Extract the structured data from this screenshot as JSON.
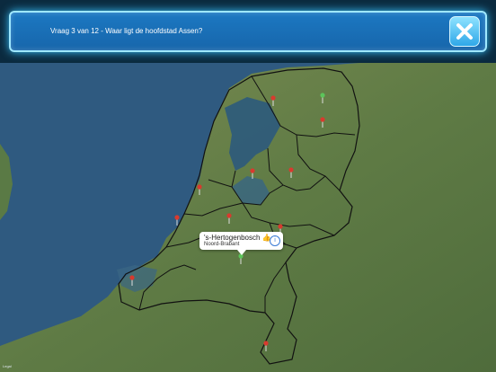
{
  "header": {
    "question": "Vraag 3 van 12 - Waar ligt de hoofdstad Assen?",
    "close_icon": "close-x-icon"
  },
  "callout": {
    "title": "'s-Hertogenbosch 👍",
    "subtitle": "Noord-Brabant",
    "info_icon": "info-icon"
  },
  "map": {
    "legal": "Legal",
    "colors": {
      "sea": "#2d5579",
      "land": "#62824a",
      "border": "#111111",
      "pin_red": "#d83a2e",
      "pin_green": "#5cc45a"
    }
  }
}
